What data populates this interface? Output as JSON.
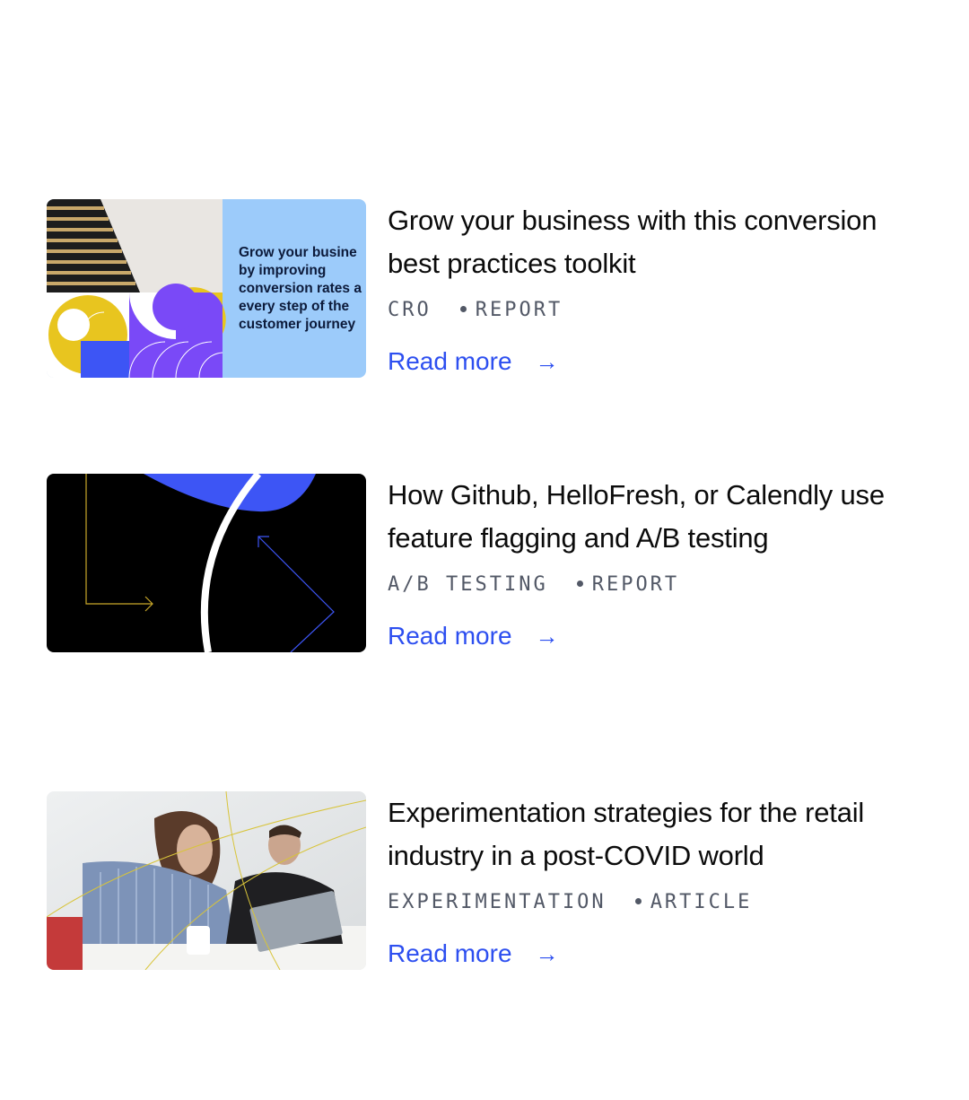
{
  "resources": [
    {
      "title": "Grow your business with this conversion best practices toolkit",
      "category": "CRO",
      "type": "REPORT",
      "link_label": "Read more",
      "image_text": [
        "Grow your busine",
        "by improving",
        "conversion rates a",
        "every step of the",
        "customer journey"
      ]
    },
    {
      "title": "How Github, HelloFresh, or Calendly use feature flagging and A/B testing",
      "category": "A/B TESTING",
      "type": "REPORT",
      "link_label": "Read more"
    },
    {
      "title": "Experimentation strategies for the retail industry in a post-COVID world",
      "category": "EXPERIMENTATION",
      "type": "ARTICLE",
      "link_label": "Read more"
    }
  ],
  "icons": {
    "link_arrow": "arrow-right-icon"
  },
  "colors": {
    "link": "#2d4ff0",
    "meta": "#525866",
    "accent_yellow": "#e6c619",
    "accent_blue": "#3d55f5",
    "accent_purple": "#7a49f7",
    "light_blue": "#99c9fb"
  }
}
